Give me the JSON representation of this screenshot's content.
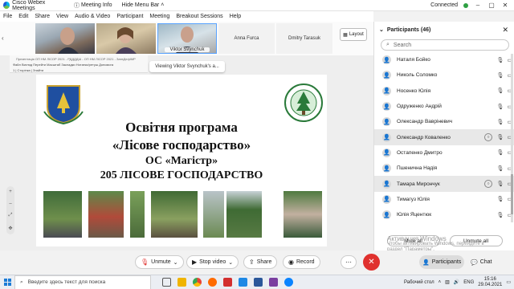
{
  "window": {
    "app_title": "Cisco Webex Meetings",
    "meeting_info": "Meeting Info",
    "hide_menu_bar": "Hide Menu Bar",
    "status": "Connected"
  },
  "menu": [
    "File",
    "Edit",
    "Share",
    "View",
    "Audio & Video",
    "Participant",
    "Meeting",
    "Breakout Sessions",
    "Help"
  ],
  "strip": {
    "tiles": [
      {
        "label": ""
      },
      {
        "label": ""
      },
      {
        "label": "Viktor Svynchuk"
      },
      {
        "label": "Anna Furca"
      },
      {
        "label": "Dmitry Tarasuk"
      }
    ],
    "layout_label": "Layout"
  },
  "share": {
    "viewer_title": "Презентація ОП НМ ЛІСОР 2021 - РДДДДШ - ОП НМ ЛІСОР 2021 - ЗатвДефІМР",
    "viewer_menu": "Файл  Вигляд  Перейти  Масштаб  Закладки  Нотатки/ретуш  Допомога",
    "viewer_status": "1  |  Сторінка          |  Знайти",
    "viewing_label": "Viewing Viktor Svynchuk's a...",
    "slide": {
      "line1": "Освітня програма",
      "line2": "«Лісове господарство»",
      "line3": "ОС «Магістр»",
      "line4": "205 ЛІСОВЕ ГОСПОДАРСТВО"
    }
  },
  "participants": {
    "header": "Participants (46)",
    "search_placeholder": "Search",
    "list": [
      {
        "name": "Наталя Бойко",
        "highlight": false,
        "chat": false
      },
      {
        "name": "Николь Соломко",
        "highlight": false,
        "chat": false
      },
      {
        "name": "Носенко Юлія",
        "highlight": false,
        "chat": false
      },
      {
        "name": "Одруженко Андрій",
        "highlight": false,
        "chat": false
      },
      {
        "name": "Олександр Вавріневич",
        "highlight": false,
        "chat": false
      },
      {
        "name": "Олександр Коваленко",
        "highlight": true,
        "chat": true
      },
      {
        "name": "Остапенко Дмитро",
        "highlight": false,
        "chat": false
      },
      {
        "name": "Пшенична Надія",
        "highlight": false,
        "chat": false
      },
      {
        "name": "Тамара Мирончук",
        "highlight": true,
        "chat": true
      },
      {
        "name": "Тимагуз Юлія",
        "highlight": false,
        "chat": false
      },
      {
        "name": "Юлія Яцентюк",
        "highlight": false,
        "chat": false
      }
    ],
    "mute_all": "Mute all",
    "unmute_all": "Unmute all"
  },
  "watermark": {
    "line1": "Активация Windows",
    "line2": "Чтобы активировать Windows, перейдите в",
    "line3": "раздел \"Параметры\"."
  },
  "toolbar": {
    "unmute": "Unmute",
    "stop_video": "Stop video",
    "share": "Share",
    "record": "Record",
    "participants": "Participants",
    "chat": "Chat"
  },
  "taskbar": {
    "search_placeholder": "Введите здесь текст для поиска",
    "desktop_label": "Рабочий стол",
    "language": "ENG",
    "time": "15:16",
    "date": "29.04.2021"
  },
  "colors": {
    "end_call": "#e0312e",
    "connected": "#2ea043",
    "win_blue": "#1c7cd6"
  }
}
